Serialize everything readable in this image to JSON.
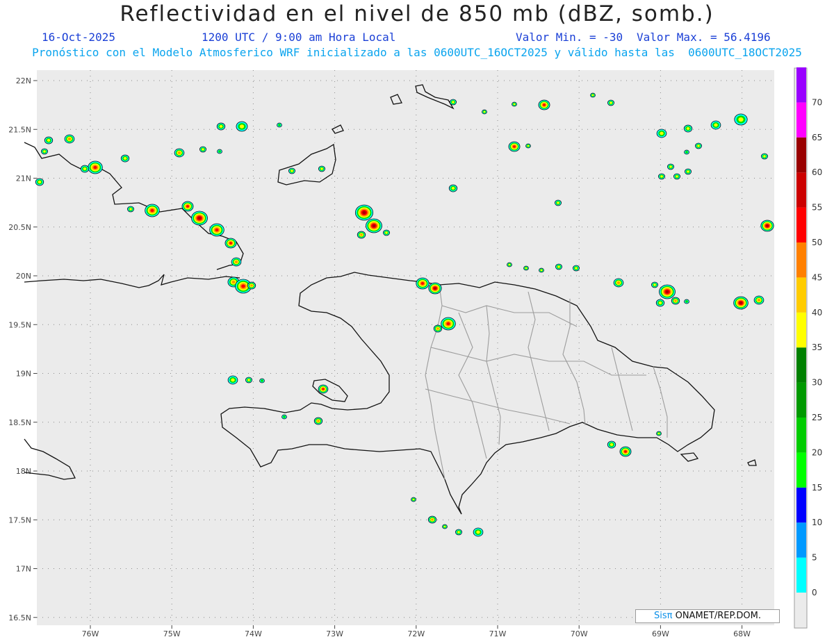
{
  "title": "Reflectividad en el nivel de 850 mb (dBZ, somb.)",
  "date": "16-Oct-2025",
  "time": "1200 UTC / 9:00 am Hora Local",
  "valmin": "Valor Min. = -30",
  "valmax": "Valor Max. = 56.4196",
  "subtitle": "Pronóstico con el Modelo Atmosferico WRF inicializado a las 0600UTC_16OCT2025 y válido hasta las  0600UTC_18OCT2025",
  "credit": {
    "brand": "Sisπ",
    "text": " ONAMET/REP.DOM."
  },
  "map": {
    "lon_range": [
      -76.65,
      -67.6
    ],
    "lat_range": [
      17.4,
      22.1
    ],
    "lat_labels": [
      "22N",
      "21.5N",
      "21N",
      "20.5N",
      "20N",
      "19.5N",
      "19N",
      "18.5N",
      "18N",
      "17.5N",
      "17N",
      "16.5N"
    ],
    "lat_values": [
      22,
      21.5,
      21,
      20.5,
      20,
      19.5,
      19,
      18.5,
      18,
      17.5,
      17,
      16.5
    ],
    "lon_labels": [
      "76W",
      "75W",
      "74W",
      "73W",
      "72W",
      "71W",
      "70W",
      "69W",
      "68W"
    ],
    "lon_values": [
      -76,
      -75,
      -74,
      -73,
      -72,
      -71,
      -70,
      -69,
      -68
    ]
  },
  "colorbar": {
    "labels": [
      "0",
      "5",
      "10",
      "15",
      "20",
      "25",
      "30",
      "35",
      "40",
      "45",
      "50",
      "55",
      "60",
      "65",
      "70"
    ],
    "colors": [
      "#00ffff",
      "#0099ff",
      "#0000ff",
      "#00ff00",
      "#00cc00",
      "#009900",
      "#008000",
      "#ffff00",
      "#ffcc00",
      "#ff8000",
      "#ff0000",
      "#cc0000",
      "#990000",
      "#ff00ff",
      "#9900ff"
    ]
  }
}
